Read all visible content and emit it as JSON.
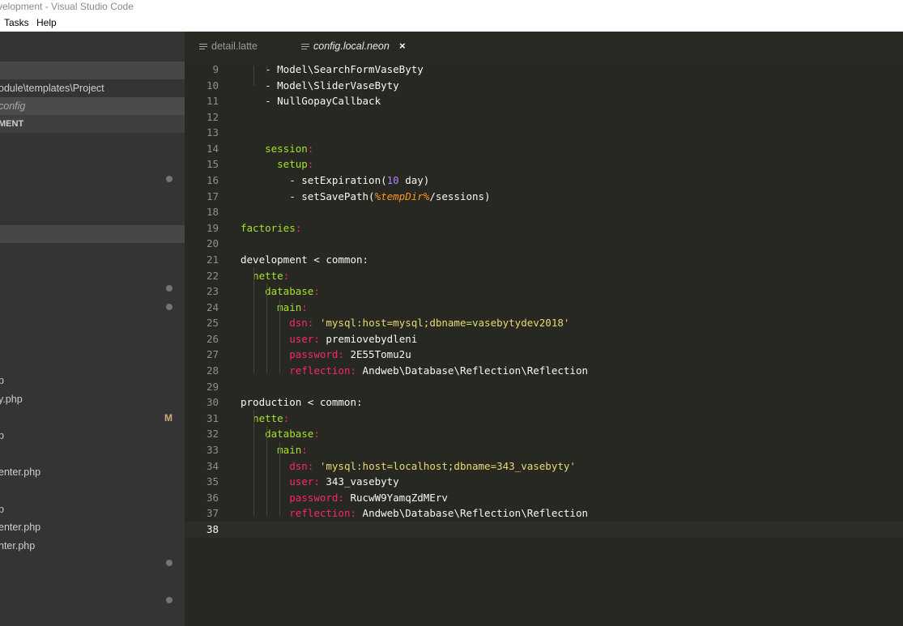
{
  "window": {
    "title": "velopment - Visual Studio Code"
  },
  "menu": [
    "Tasks",
    "Help"
  ],
  "sidebar": {
    "path_row": "odule\\templates\\Project",
    "selected_file": "config",
    "section_label": "MENT",
    "files": [
      {
        "name": "p"
      },
      {
        "name": "y.php"
      },
      {
        "name": "p"
      },
      {
        "name": "enter.php"
      },
      {
        "name": "p"
      },
      {
        "name": "enter.php"
      },
      {
        "name": "nter.php"
      }
    ],
    "badge": "M"
  },
  "tabs": [
    {
      "label": "detail.latte",
      "active": false
    },
    {
      "label": "config.local.neon",
      "active": true,
      "close": "×"
    }
  ],
  "editor": {
    "lines": [
      {
        "n": "9",
        "t": [
          [
            "    - Model\\SearchFormVaseByty",
            ""
          ]
        ]
      },
      {
        "n": "10",
        "t": [
          [
            "    - Model\\SliderVaseByty",
            ""
          ]
        ]
      },
      {
        "n": "11",
        "t": [
          [
            "    - NullGopayCallback",
            ""
          ]
        ]
      },
      {
        "n": "12",
        "t": []
      },
      {
        "n": "13",
        "t": []
      },
      {
        "n": "14",
        "t": [
          [
            "    ",
            ""
          ],
          [
            "session",
            "green"
          ],
          [
            ":",
            "pink"
          ]
        ]
      },
      {
        "n": "15",
        "t": [
          [
            "      ",
            ""
          ],
          [
            "setup",
            "green"
          ],
          [
            ":",
            "pink"
          ]
        ]
      },
      {
        "n": "16",
        "t": [
          [
            "        - setExpiration(",
            ""
          ],
          [
            "10",
            "num"
          ],
          [
            " day)",
            ""
          ]
        ]
      },
      {
        "n": "17",
        "t": [
          [
            "        - setSavePath(",
            ""
          ],
          [
            "%tempDir%",
            "var"
          ],
          [
            "/sessions)",
            ""
          ]
        ]
      },
      {
        "n": "18",
        "t": []
      },
      {
        "n": "19",
        "t": [
          [
            "factories",
            "green"
          ],
          [
            ":",
            "pink"
          ]
        ]
      },
      {
        "n": "20",
        "t": []
      },
      {
        "n": "21",
        "t": [
          [
            "development < common:",
            ""
          ]
        ]
      },
      {
        "n": "22",
        "t": [
          [
            "  ",
            ""
          ],
          [
            "nette",
            "green"
          ],
          [
            ":",
            "pink"
          ]
        ]
      },
      {
        "n": "23",
        "t": [
          [
            "    ",
            ""
          ],
          [
            "database",
            "green"
          ],
          [
            ":",
            "pink"
          ]
        ]
      },
      {
        "n": "24",
        "t": [
          [
            "      ",
            ""
          ],
          [
            "main",
            "green"
          ],
          [
            ":",
            "pink"
          ]
        ]
      },
      {
        "n": "25",
        "t": [
          [
            "        ",
            ""
          ],
          [
            "dsn:",
            "pink"
          ],
          [
            " ",
            ""
          ],
          [
            "'mysql:host=mysql;dbname=vasebytydev2018'",
            "str"
          ]
        ]
      },
      {
        "n": "26",
        "t": [
          [
            "        ",
            ""
          ],
          [
            "user:",
            "pink"
          ],
          [
            " premiovebydleni",
            ""
          ]
        ]
      },
      {
        "n": "27",
        "t": [
          [
            "        ",
            ""
          ],
          [
            "password:",
            "pink"
          ],
          [
            " 2E55Tomu2u",
            ""
          ]
        ]
      },
      {
        "n": "28",
        "t": [
          [
            "        ",
            ""
          ],
          [
            "reflection:",
            "pink"
          ],
          [
            " Andweb\\Database\\Reflection\\Reflection",
            ""
          ]
        ]
      },
      {
        "n": "29",
        "t": []
      },
      {
        "n": "30",
        "t": [
          [
            "production < common:",
            ""
          ]
        ]
      },
      {
        "n": "31",
        "t": [
          [
            "  ",
            ""
          ],
          [
            "nette",
            "green"
          ],
          [
            ":",
            "pink"
          ]
        ]
      },
      {
        "n": "32",
        "t": [
          [
            "    ",
            ""
          ],
          [
            "database",
            "green"
          ],
          [
            ":",
            "pink"
          ]
        ]
      },
      {
        "n": "33",
        "t": [
          [
            "      ",
            ""
          ],
          [
            "main",
            "green"
          ],
          [
            ":",
            "pink"
          ]
        ]
      },
      {
        "n": "34",
        "t": [
          [
            "        ",
            ""
          ],
          [
            "dsn:",
            "pink"
          ],
          [
            " ",
            ""
          ],
          [
            "'mysql:host=localhost;dbname=343_vasebyty'",
            "str"
          ]
        ]
      },
      {
        "n": "35",
        "t": [
          [
            "        ",
            ""
          ],
          [
            "user:",
            "pink"
          ],
          [
            " 343_vasebyty",
            ""
          ]
        ]
      },
      {
        "n": "36",
        "t": [
          [
            "        ",
            ""
          ],
          [
            "password:",
            "pink"
          ],
          [
            " RucwW9YamqZdMErv",
            ""
          ]
        ]
      },
      {
        "n": "37",
        "t": [
          [
            "        ",
            ""
          ],
          [
            "reflection:",
            "pink"
          ],
          [
            " Andweb\\Database\\Reflection\\Reflection",
            ""
          ]
        ]
      },
      {
        "n": "38",
        "t": [],
        "current": true
      }
    ]
  }
}
